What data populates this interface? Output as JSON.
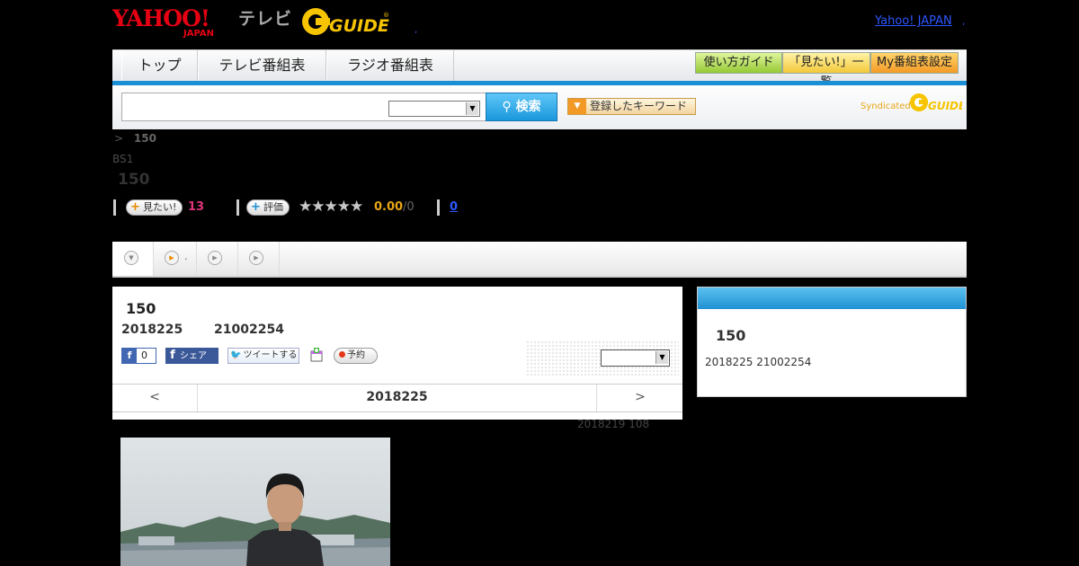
{
  "header": {
    "logo_text": "YAHOO! JAPAN",
    "tv_label": "テレビ",
    "gguide_logo": "G GUIDE",
    "yahoo_link": "Yahoo! JAPAN"
  },
  "nav": {
    "tabs": [
      "トップ",
      "テレビ番組表",
      "ラジオ番組表"
    ],
    "guide_button": "使い方ガイド",
    "mitai_list_button": "「見たい!」一覧",
    "my_schedule_button": "My番組表設定"
  },
  "search": {
    "input_value": "",
    "select_value": "",
    "button_label": "検索",
    "keyword_button": "登録したキーワード",
    "syndicated_label": "Syndicated"
  },
  "program": {
    "breadcrumb_sep": ">",
    "breadcrumb_current": "150",
    "channel": "BS1",
    "title": "150",
    "mitai_label": "見たい!",
    "mitai_count": "13",
    "rating_label": "評価",
    "stars": "★★★★★",
    "rating": "0.00",
    "rating_max": "/0",
    "comment_count": "0"
  },
  "tabs_strip": {
    "tab2_text": "."
  },
  "main": {
    "title": "150",
    "date": "2018225",
    "time": "21002254",
    "fb_like_count": "0",
    "fb_share_label": "シェア",
    "tweet_label": "ツイートする",
    "yoyaku_label": "予約",
    "select_value": "",
    "prev_label": "<",
    "current_day": "2018225",
    "next_label": ">",
    "update_note": "2018219  108"
  },
  "side": {
    "title": "150",
    "date_time": "2018225  21002254"
  },
  "colors": {
    "accent_blue": "#1a8fd6",
    "mitai_pink": "#e0347a",
    "rating_orange": "#e8a617",
    "link_blue": "#2e57ff"
  }
}
